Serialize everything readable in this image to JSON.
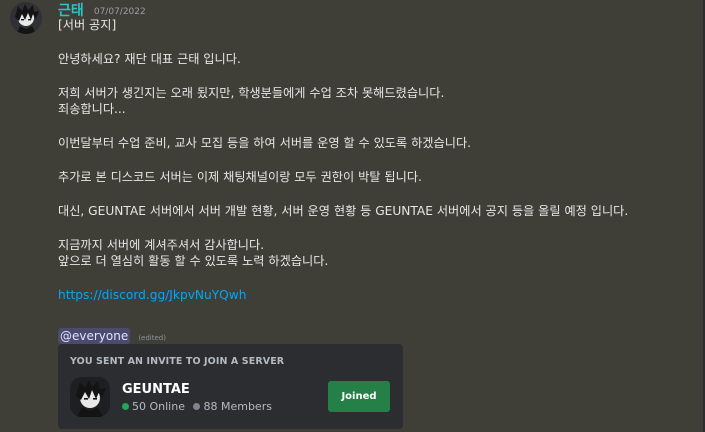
{
  "message": {
    "author": "근태",
    "timestamp": "07/07/2022",
    "author_color": "#2cc3c8",
    "lines": [
      "[서버 공지]",
      "",
      "안녕하세요? 재단 대표 근태 입니다.",
      "",
      "저희 서버가 생긴지는 오래 됬지만, 학생분들에게 수업 조차 못해드렸습니다.",
      "죄송합니다...",
      "",
      "이번달부터 수업 준비, 교사 모집 등을 하여 서버를 운영 할 수 있도록 하겠습니다.",
      "",
      "추가로 본 디스코드 서버는 이제 채팅채널이랑 모두 권한이 박탈 됩니다.",
      "",
      "대신, GEUNTAE 서버에서 서버 개발 현황, 서버 운영 현황 등 GEUNTAE 서버에서 공지 등을 올릴 예정 입니다.",
      "",
      "지금까지 서버에 계셔주셔서 감사합니다.",
      "앞으로 더 열심히 활동 할 수 있도록 노력 하겠습니다."
    ],
    "link": "https://discord.gg/JkpvNuYQwh",
    "mention": "@everyone",
    "edited_label": "(edited)"
  },
  "invite": {
    "heading": "YOU SENT AN INVITE TO JOIN A SERVER",
    "server_name": "GEUNTAE",
    "online": "50 Online",
    "members": "88 Members",
    "button_label": "Joined",
    "button_color": "#248046"
  },
  "icons": {
    "avatar": "anime-boy-avatar-icon",
    "server": "anime-boy-server-icon"
  }
}
